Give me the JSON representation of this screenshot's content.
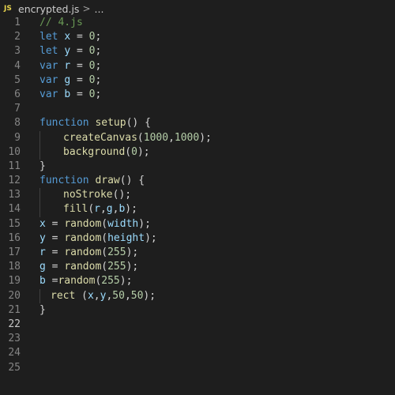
{
  "breadcrumb": {
    "file_icon": "JS",
    "file_name": "encrypted.js",
    "chevron": ">",
    "ellipsis": "..."
  },
  "colors": {
    "background": "#1e1e1e",
    "comment": "#6a9955",
    "keyword": "#569cd6",
    "variable": "#9cdcfe",
    "number": "#b5cea8",
    "function": "#dcdcaa",
    "plain": "#d4d4d4",
    "js_icon": "#e8d44d"
  },
  "current_line": 22,
  "lines": [
    {
      "n": "1",
      "indent": 0,
      "tokens": [
        {
          "t": "comment",
          "v": "// 4.js"
        }
      ]
    },
    {
      "n": "2",
      "indent": 0,
      "tokens": [
        {
          "t": "keyword",
          "v": "let"
        },
        {
          "t": "plain",
          "v": " "
        },
        {
          "t": "var",
          "v": "x"
        },
        {
          "t": "plain",
          "v": " = "
        },
        {
          "t": "number",
          "v": "0"
        },
        {
          "t": "plain",
          "v": ";"
        }
      ]
    },
    {
      "n": "3",
      "indent": 0,
      "tokens": [
        {
          "t": "keyword",
          "v": "let"
        },
        {
          "t": "plain",
          "v": " "
        },
        {
          "t": "var",
          "v": "y"
        },
        {
          "t": "plain",
          "v": " = "
        },
        {
          "t": "number",
          "v": "0"
        },
        {
          "t": "plain",
          "v": ";"
        }
      ]
    },
    {
      "n": "4",
      "indent": 0,
      "tokens": [
        {
          "t": "keyword",
          "v": "var"
        },
        {
          "t": "plain",
          "v": " "
        },
        {
          "t": "var",
          "v": "r"
        },
        {
          "t": "plain",
          "v": " = "
        },
        {
          "t": "number",
          "v": "0"
        },
        {
          "t": "plain",
          "v": ";"
        }
      ]
    },
    {
      "n": "5",
      "indent": 0,
      "tokens": [
        {
          "t": "keyword",
          "v": "var"
        },
        {
          "t": "plain",
          "v": " "
        },
        {
          "t": "var",
          "v": "g"
        },
        {
          "t": "plain",
          "v": " = "
        },
        {
          "t": "number",
          "v": "0"
        },
        {
          "t": "plain",
          "v": ";"
        }
      ]
    },
    {
      "n": "6",
      "indent": 0,
      "tokens": [
        {
          "t": "keyword",
          "v": "var"
        },
        {
          "t": "plain",
          "v": " "
        },
        {
          "t": "var",
          "v": "b"
        },
        {
          "t": "plain",
          "v": " = "
        },
        {
          "t": "number",
          "v": "0"
        },
        {
          "t": "plain",
          "v": ";"
        }
      ]
    },
    {
      "n": "7",
      "indent": 0,
      "tokens": []
    },
    {
      "n": "8",
      "indent": 0,
      "tokens": [
        {
          "t": "keyword",
          "v": "function"
        },
        {
          "t": "plain",
          "v": " "
        },
        {
          "t": "func",
          "v": "setup"
        },
        {
          "t": "plain",
          "v": "() {"
        }
      ]
    },
    {
      "n": "9",
      "indent": 1,
      "tokens": [
        {
          "t": "func",
          "v": "createCanvas"
        },
        {
          "t": "plain",
          "v": "("
        },
        {
          "t": "number",
          "v": "1000"
        },
        {
          "t": "plain",
          "v": ","
        },
        {
          "t": "number",
          "v": "1000"
        },
        {
          "t": "plain",
          "v": ");"
        }
      ]
    },
    {
      "n": "10",
      "indent": 1,
      "tokens": [
        {
          "t": "func",
          "v": "background"
        },
        {
          "t": "plain",
          "v": "("
        },
        {
          "t": "number",
          "v": "0"
        },
        {
          "t": "plain",
          "v": ");"
        }
      ]
    },
    {
      "n": "11",
      "indent": 0,
      "tokens": [
        {
          "t": "plain",
          "v": "}"
        }
      ]
    },
    {
      "n": "12",
      "indent": 0,
      "tokens": [
        {
          "t": "keyword",
          "v": "function"
        },
        {
          "t": "plain",
          "v": " "
        },
        {
          "t": "func",
          "v": "draw"
        },
        {
          "t": "plain",
          "v": "() {"
        }
      ]
    },
    {
      "n": "13",
      "indent": 1,
      "tokens": [
        {
          "t": "func",
          "v": "noStroke"
        },
        {
          "t": "plain",
          "v": "();"
        }
      ]
    },
    {
      "n": "14",
      "indent": 1,
      "tokens": [
        {
          "t": "func",
          "v": "fill"
        },
        {
          "t": "plain",
          "v": "("
        },
        {
          "t": "var",
          "v": "r"
        },
        {
          "t": "plain",
          "v": ","
        },
        {
          "t": "var",
          "v": "g"
        },
        {
          "t": "plain",
          "v": ","
        },
        {
          "t": "var",
          "v": "b"
        },
        {
          "t": "plain",
          "v": ");"
        }
      ]
    },
    {
      "n": "15",
      "indent": 0,
      "tokens": [
        {
          "t": "var",
          "v": "x"
        },
        {
          "t": "plain",
          "v": " = "
        },
        {
          "t": "func",
          "v": "random"
        },
        {
          "t": "plain",
          "v": "("
        },
        {
          "t": "var",
          "v": "width"
        },
        {
          "t": "plain",
          "v": ");"
        }
      ]
    },
    {
      "n": "16",
      "indent": 0,
      "tokens": [
        {
          "t": "var",
          "v": "y"
        },
        {
          "t": "plain",
          "v": " = "
        },
        {
          "t": "func",
          "v": "random"
        },
        {
          "t": "plain",
          "v": "("
        },
        {
          "t": "var",
          "v": "height"
        },
        {
          "t": "plain",
          "v": ");"
        }
      ]
    },
    {
      "n": "17",
      "indent": 0,
      "tokens": [
        {
          "t": "var",
          "v": "r"
        },
        {
          "t": "plain",
          "v": " = "
        },
        {
          "t": "func",
          "v": "random"
        },
        {
          "t": "plain",
          "v": "("
        },
        {
          "t": "number",
          "v": "255"
        },
        {
          "t": "plain",
          "v": ");"
        }
      ]
    },
    {
      "n": "18",
      "indent": 0,
      "tokens": [
        {
          "t": "var",
          "v": "g"
        },
        {
          "t": "plain",
          "v": " = "
        },
        {
          "t": "func",
          "v": "random"
        },
        {
          "t": "plain",
          "v": "("
        },
        {
          "t": "number",
          "v": "255"
        },
        {
          "t": "plain",
          "v": ");"
        }
      ]
    },
    {
      "n": "19",
      "indent": 0,
      "tokens": [
        {
          "t": "var",
          "v": "b"
        },
        {
          "t": "plain",
          "v": " ="
        },
        {
          "t": "func",
          "v": "random"
        },
        {
          "t": "plain",
          "v": "("
        },
        {
          "t": "number",
          "v": "255"
        },
        {
          "t": "plain",
          "v": ");"
        }
      ]
    },
    {
      "n": "20",
      "indent": 2,
      "tokens": [
        {
          "t": "func",
          "v": "rect"
        },
        {
          "t": "plain",
          "v": " ("
        },
        {
          "t": "var",
          "v": "x"
        },
        {
          "t": "plain",
          "v": ","
        },
        {
          "t": "var",
          "v": "y"
        },
        {
          "t": "plain",
          "v": ","
        },
        {
          "t": "number",
          "v": "50"
        },
        {
          "t": "plain",
          "v": ","
        },
        {
          "t": "number",
          "v": "50"
        },
        {
          "t": "plain",
          "v": ");"
        }
      ]
    },
    {
      "n": "21",
      "indent": 0,
      "tokens": [
        {
          "t": "plain",
          "v": "}"
        }
      ]
    },
    {
      "n": "22",
      "indent": 0,
      "tokens": []
    },
    {
      "n": "23",
      "indent": 0,
      "tokens": []
    },
    {
      "n": "24",
      "indent": 0,
      "tokens": []
    },
    {
      "n": "25",
      "indent": 0,
      "tokens": []
    }
  ]
}
